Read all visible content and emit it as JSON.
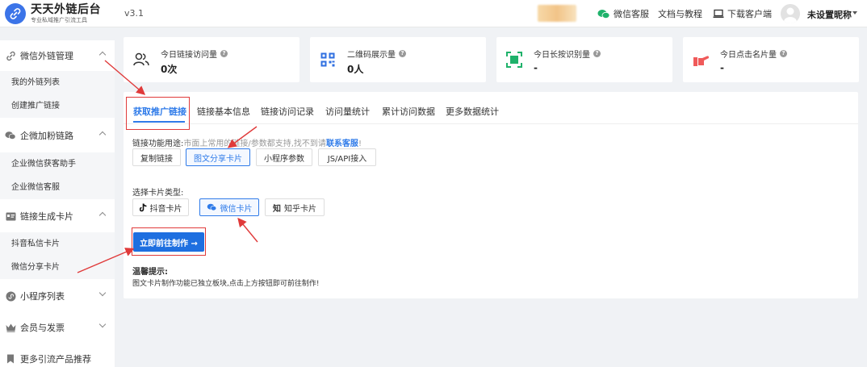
{
  "app": {
    "title": "天天外链后台",
    "subtitle": "专业私域推广引流工具",
    "version": "v3.1"
  },
  "header": {
    "service": "微信客服",
    "docs": "文档与教程",
    "download": "下载客户端",
    "nickname": "未设置昵称"
  },
  "sidebar": {
    "groups": [
      {
        "label": "微信外链管理",
        "icon": "link-icon",
        "expanded": true,
        "items": [
          "我的外链列表",
          "创建推广链接"
        ]
      },
      {
        "label": "企微加粉链路",
        "icon": "chat-bubble-icon",
        "expanded": true,
        "items": [
          "企业微信获客助手",
          "企业微信客服"
        ]
      },
      {
        "label": "链接生成卡片",
        "icon": "card-icon",
        "expanded": true,
        "items": [
          "抖音私信卡片",
          "微信分享卡片"
        ]
      },
      {
        "label": "小程序列表",
        "icon": "miniprogram-icon",
        "expanded": false,
        "items": []
      },
      {
        "label": "会员与发票",
        "icon": "crown-icon",
        "expanded": false,
        "items": []
      },
      {
        "label": "更多引流产品推荐",
        "icon": "bookmark-icon",
        "expanded": false,
        "items": []
      }
    ]
  },
  "stats": [
    {
      "label": "今日链接访问量",
      "value": "0次",
      "icon": "users-icon",
      "color": "#333333"
    },
    {
      "label": "二维码展示量",
      "value": "0人",
      "icon": "qrcode-icon",
      "color": "#2f6fe0"
    },
    {
      "label": "今日长按识别量",
      "value": "-",
      "icon": "scan-icon",
      "color": "#1fb26b"
    },
    {
      "label": "今日点击名片量",
      "value": "-",
      "icon": "hand-pointer-icon",
      "color": "#f05a5a"
    }
  ],
  "tabs": [
    "获取推广链接",
    "链接基本信息",
    "链接访问记录",
    "访问量统计",
    "累计访问数据",
    "更多数据统计"
  ],
  "content": {
    "uses_label": "链接功能用途:",
    "uses_hint": "市面上常用的链接/参数都支持,找不到请",
    "contact": "联系客服",
    "uses_end": "!",
    "use_buttons": [
      "复制链接",
      "图文分享卡片",
      "小程序参数",
      "JS/API接入"
    ],
    "selected_use": "图文分享卡片",
    "card_type_label": "选择卡片类型:",
    "card_buttons": [
      "抖音卡片",
      "微信卡片",
      "知乎卡片"
    ],
    "selected_card": "微信卡片",
    "go_button": "立即前往制作 →",
    "tips_title": "温馨提示:",
    "tips_text": "图文卡片制作功能已独立板块,点击上方按钮即可前往制作!"
  },
  "colors": {
    "accent": "#2f7be9",
    "annotation": "#e03a3a"
  }
}
